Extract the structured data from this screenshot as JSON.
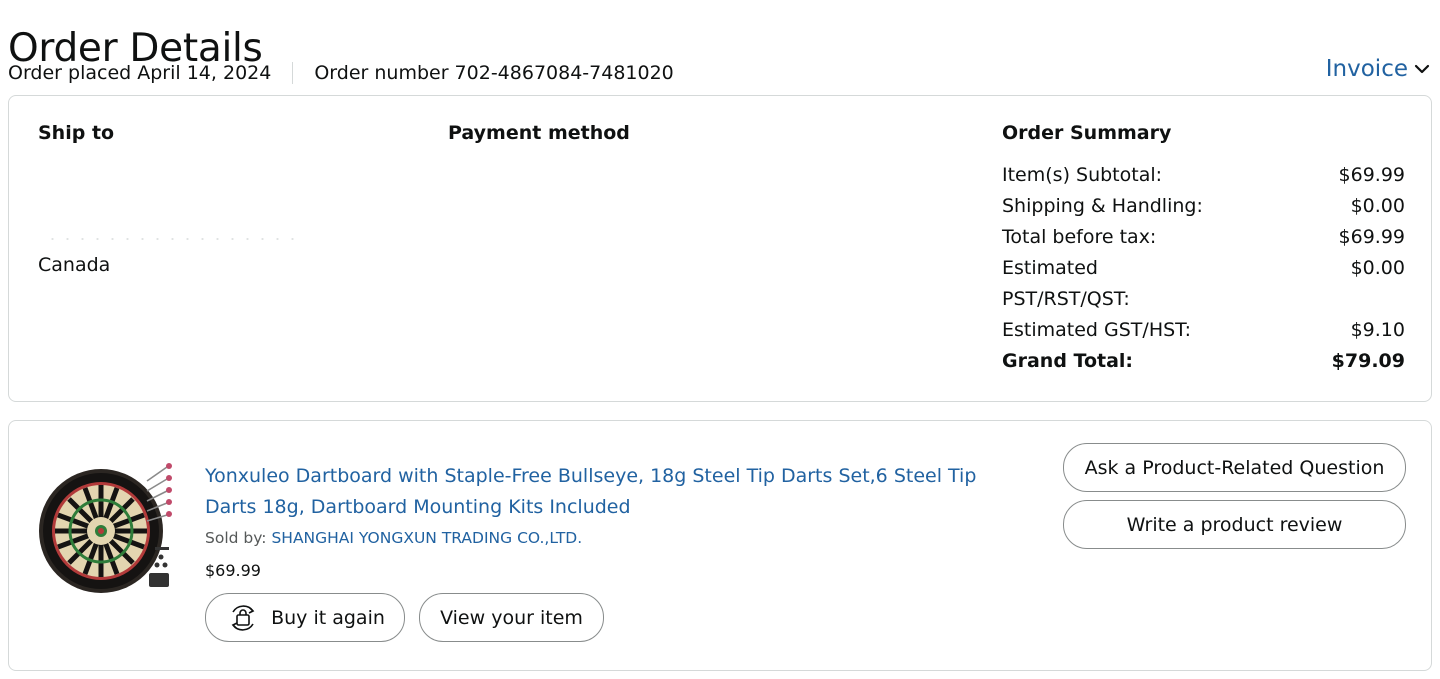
{
  "page": {
    "title": "Order Details"
  },
  "order_meta": {
    "placed": "Order placed April 14, 2024",
    "number": "Order number 702-4867084-7481020"
  },
  "invoice": {
    "label": "Invoice",
    "icon": "chevron-down-icon"
  },
  "details": {
    "ship_to": {
      "title": "Ship to",
      "country": "Canada"
    },
    "payment": {
      "title": "Payment method"
    },
    "summary": {
      "title": "Order Summary",
      "rows": [
        {
          "label": "Item(s) Subtotal:",
          "value": "$69.99"
        },
        {
          "label": "Shipping & Handling:",
          "value": "$0.00"
        },
        {
          "label": "Total before tax:",
          "value": "$69.99"
        },
        {
          "label": "Estimated PST/RST/QST:",
          "value": "$0.00"
        },
        {
          "label": "Estimated GST/HST:",
          "value": "$9.10"
        },
        {
          "label": "Grand Total:",
          "value": "$79.09"
        }
      ]
    }
  },
  "item": {
    "title": "Yonxuleo Dartboard with Staple-Free Bullseye, 18g Steel Tip Darts Set,6 Steel Tip Darts 18g, Dartboard Mounting Kits Included",
    "sold_by_label": "Sold by:",
    "seller": "SHANGHAI YONGXUN TRADING CO.,LTD.",
    "price": "$69.99",
    "image_icon": "dartboard-product-image",
    "buttons": {
      "buy_again": "Buy it again",
      "view_item": "View your item",
      "ask_question": "Ask a Product-Related Question",
      "write_review": "Write a product review"
    }
  },
  "colors": {
    "link": "#2162a1",
    "border": "#d5d9d9",
    "text": "#0f1111",
    "muted": "#565959"
  }
}
